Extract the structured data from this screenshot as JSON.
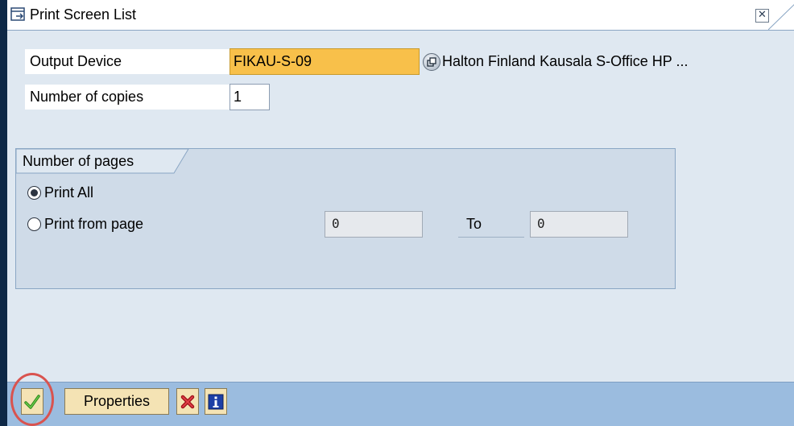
{
  "dialog": {
    "title": "Print Screen List",
    "close_icon": "close-icon"
  },
  "form": {
    "output_device": {
      "label": "Output Device",
      "value": "FIKAU-S-09",
      "description": "Halton Finland Kausala S-Office HP ..."
    },
    "copies": {
      "label": "Number of copies",
      "value": "1"
    }
  },
  "pages_group": {
    "title": "Number of pages",
    "print_all_label": "Print All",
    "print_all_selected": true,
    "print_from_label": "Print from page",
    "from_value": "0",
    "to_label": "To",
    "to_value": "0"
  },
  "toolbar": {
    "properties_label": "Properties",
    "continue_icon": "checkmark-icon",
    "cancel_icon": "cancel-icon",
    "info_icon": "info-icon"
  },
  "colors": {
    "required_field": "#f8c04a",
    "background": "#dfe8f1",
    "toolbar": "#9bbcdf",
    "highlight": "#d9534f"
  }
}
